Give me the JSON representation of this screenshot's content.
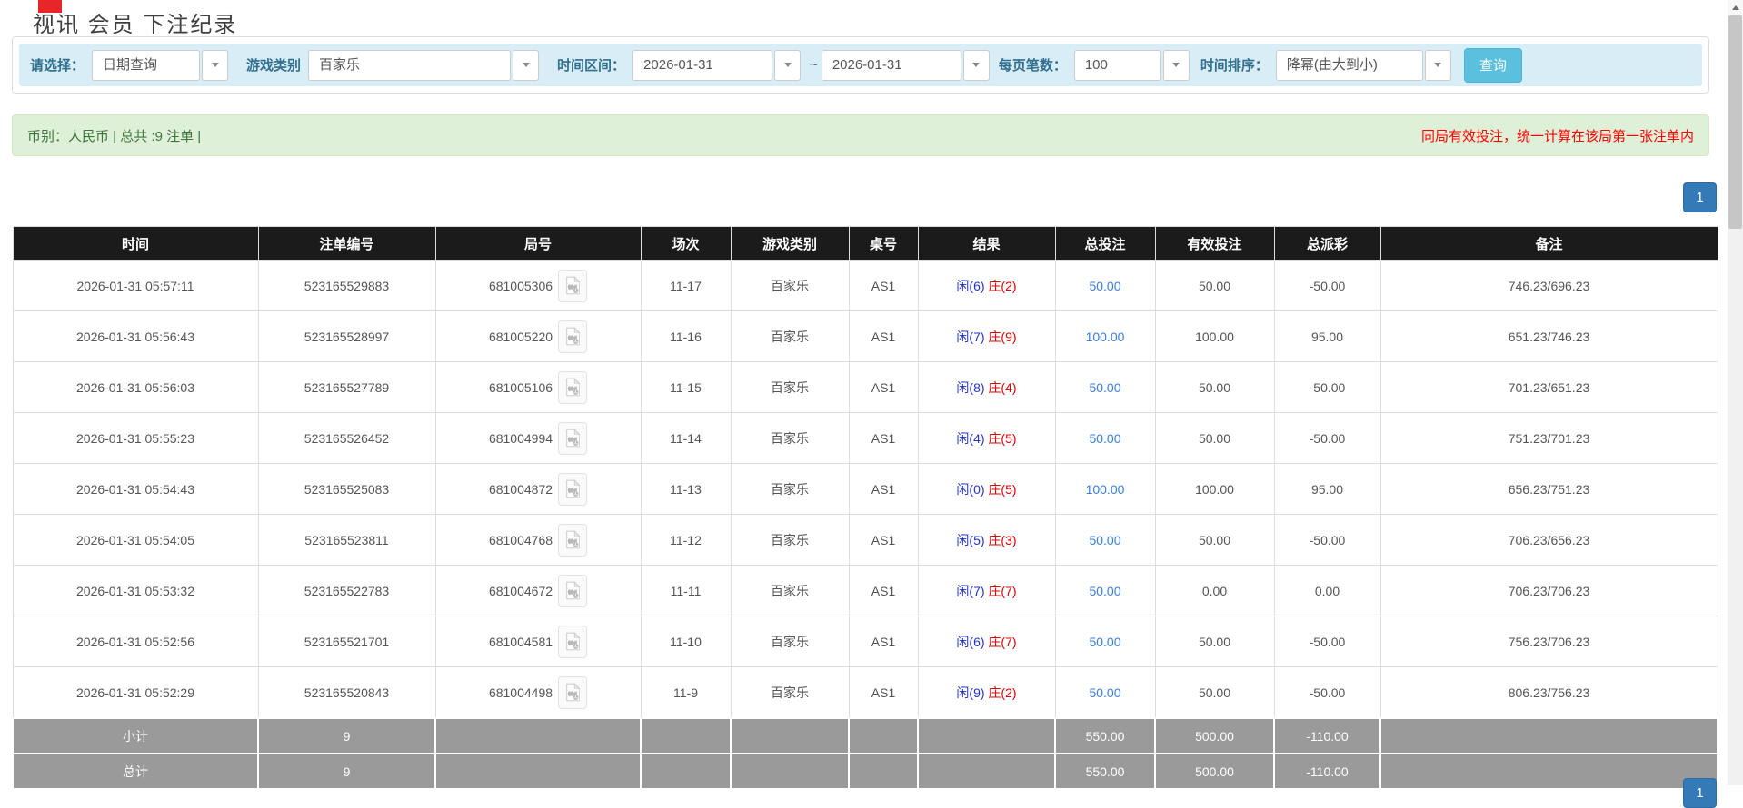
{
  "page": {
    "title": "视讯 会员 下注纪录"
  },
  "filters": {
    "select_label": "请选择：",
    "select_value": "日期查询",
    "game_label": "游戏类别",
    "game_value": "百家乐",
    "range_label": "时间区间：",
    "date_from": "2026-01-31",
    "range_sep": "~",
    "date_to": "2026-01-31",
    "per_page_label": "每页笔数：",
    "per_page_value": "100",
    "sort_label": "时间排序：",
    "sort_value": "降幂(由大到小)",
    "query_button": "查询"
  },
  "summary": {
    "left": "币别：人民币 | 总共 :9 注单 |",
    "right": "同局有效投注，统一计算在该局第一张注单内"
  },
  "pagination": {
    "page": "1"
  },
  "colors": {
    "header_bg": "#1b1b1b",
    "footer_bg": "#9a9a9a",
    "filter_bar_bg": "#d9edf7",
    "summary_bg": "#dff0d8",
    "summary_text": "#3c763d",
    "accent_blue": "#337ab7",
    "query_btn": "#5bc0de",
    "player_blue": "#2233cc",
    "banker_red": "#dd0000",
    "negative_red": "#f00000"
  },
  "table": {
    "headers": [
      "时间",
      "注单编号",
      "局号",
      "场次",
      "游戏类别",
      "桌号",
      "结果",
      "总投注",
      "有效投注",
      "总派彩",
      "备注"
    ],
    "rows": [
      {
        "time": "2026-01-31 05:57:11",
        "bet_id": "523165529883",
        "round": "681005306",
        "session": "11-17",
        "game": "百家乐",
        "table_no": "AS1",
        "result_player": "闲(6)",
        "result_banker": "庄(2)",
        "total_bet": "50.00",
        "valid_bet": "50.00",
        "payout": "-50.00",
        "note": "746.23/696.23"
      },
      {
        "time": "2026-01-31 05:56:43",
        "bet_id": "523165528997",
        "round": "681005220",
        "session": "11-16",
        "game": "百家乐",
        "table_no": "AS1",
        "result_player": "闲(7)",
        "result_banker": "庄(9)",
        "total_bet": "100.00",
        "valid_bet": "100.00",
        "payout": "95.00",
        "note": "651.23/746.23"
      },
      {
        "time": "2026-01-31 05:56:03",
        "bet_id": "523165527789",
        "round": "681005106",
        "session": "11-15",
        "game": "百家乐",
        "table_no": "AS1",
        "result_player": "闲(8)",
        "result_banker": "庄(4)",
        "total_bet": "50.00",
        "valid_bet": "50.00",
        "payout": "-50.00",
        "note": "701.23/651.23"
      },
      {
        "time": "2026-01-31 05:55:23",
        "bet_id": "523165526452",
        "round": "681004994",
        "session": "11-14",
        "game": "百家乐",
        "table_no": "AS1",
        "result_player": "闲(4)",
        "result_banker": "庄(5)",
        "total_bet": "50.00",
        "valid_bet": "50.00",
        "payout": "-50.00",
        "note": "751.23/701.23"
      },
      {
        "time": "2026-01-31 05:54:43",
        "bet_id": "523165525083",
        "round": "681004872",
        "session": "11-13",
        "game": "百家乐",
        "table_no": "AS1",
        "result_player": "闲(0)",
        "result_banker": "庄(5)",
        "total_bet": "100.00",
        "valid_bet": "100.00",
        "payout": "95.00",
        "note": "656.23/751.23"
      },
      {
        "time": "2026-01-31 05:54:05",
        "bet_id": "523165523811",
        "round": "681004768",
        "session": "11-12",
        "game": "百家乐",
        "table_no": "AS1",
        "result_player": "闲(5)",
        "result_banker": "庄(3)",
        "total_bet": "50.00",
        "valid_bet": "50.00",
        "payout": "-50.00",
        "note": "706.23/656.23"
      },
      {
        "time": "2026-01-31 05:53:32",
        "bet_id": "523165522783",
        "round": "681004672",
        "session": "11-11",
        "game": "百家乐",
        "table_no": "AS1",
        "result_player": "闲(7)",
        "result_banker": "庄(7)",
        "total_bet": "50.00",
        "valid_bet": "0.00",
        "payout": "0.00",
        "note": "706.23/706.23"
      },
      {
        "time": "2026-01-31 05:52:56",
        "bet_id": "523165521701",
        "round": "681004581",
        "session": "11-10",
        "game": "百家乐",
        "table_no": "AS1",
        "result_player": "闲(6)",
        "result_banker": "庄(7)",
        "total_bet": "50.00",
        "valid_bet": "50.00",
        "payout": "-50.00",
        "note": "756.23/706.23"
      },
      {
        "time": "2026-01-31 05:52:29",
        "bet_id": "523165520843",
        "round": "681004498",
        "session": "11-9",
        "game": "百家乐",
        "table_no": "AS1",
        "result_player": "闲(9)",
        "result_banker": "庄(2)",
        "total_bet": "50.00",
        "valid_bet": "50.00",
        "payout": "-50.00",
        "note": "806.23/756.23"
      }
    ],
    "footer": [
      {
        "label": "小计",
        "count": "9",
        "total_bet": "550.00",
        "valid_bet": "500.00",
        "payout": "-110.00"
      },
      {
        "label": "总计",
        "count": "9",
        "total_bet": "550.00",
        "valid_bet": "500.00",
        "payout": "-110.00"
      }
    ]
  }
}
